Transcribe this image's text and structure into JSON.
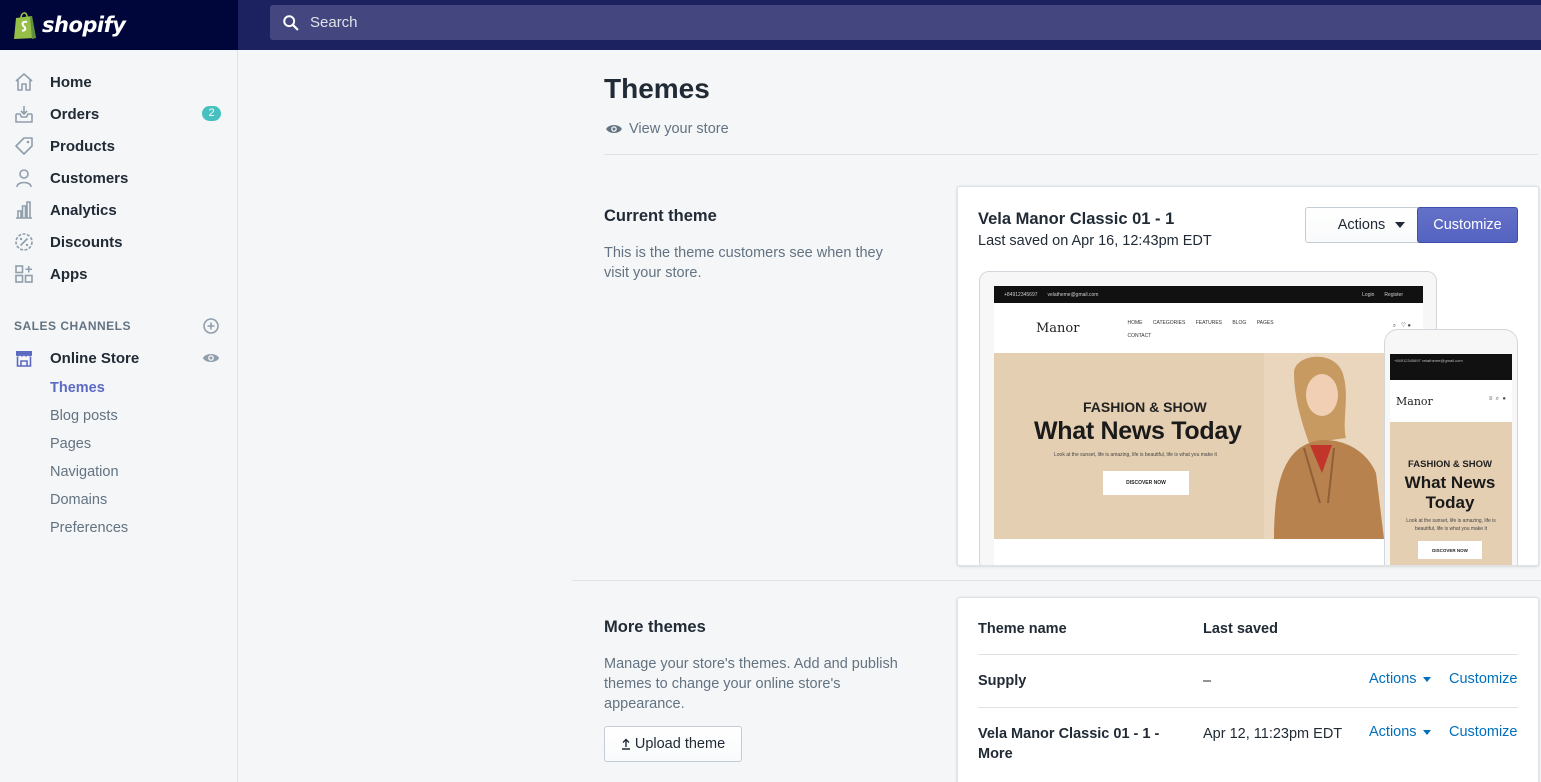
{
  "brand": {
    "name": "shopify"
  },
  "search": {
    "placeholder": "Search"
  },
  "sidebar": {
    "items": [
      {
        "label": "Home",
        "icon": "home-icon"
      },
      {
        "label": "Orders",
        "icon": "orders-icon",
        "badge": "2"
      },
      {
        "label": "Products",
        "icon": "tag-icon"
      },
      {
        "label": "Customers",
        "icon": "person-icon"
      },
      {
        "label": "Analytics",
        "icon": "bar-chart-icon"
      },
      {
        "label": "Discounts",
        "icon": "discount-icon"
      },
      {
        "label": "Apps",
        "icon": "apps-icon"
      }
    ],
    "sales_channels_heading": "SALES CHANNELS",
    "online_store": {
      "label": "Online Store",
      "icon": "store-icon"
    },
    "sub_items": [
      "Themes",
      "Blog posts",
      "Pages",
      "Navigation",
      "Domains",
      "Preferences"
    ],
    "active_sub_item": "Themes"
  },
  "page": {
    "title": "Themes",
    "view_store": "View your store"
  },
  "current_theme": {
    "heading": "Current theme",
    "description": "This is the theme customers see when they visit your store.",
    "name": "Vela Manor Classic 01 - 1",
    "last_saved": "Last saved on Apr 16, 12:43pm EDT",
    "actions_label": "Actions",
    "customize_label": "Customize",
    "preview": {
      "topbar_phone": "+84912345697",
      "topbar_email": "velatheme@gmail.com",
      "topbar_login": "Login",
      "topbar_register": "Register",
      "logo": "Manor",
      "menu": [
        "HOME",
        "CATEGORIES",
        "FEATURES",
        "BLOG",
        "PAGES",
        "CONTACT"
      ],
      "hero_kicker": "FASHION & SHOW",
      "hero_title": "What News Today",
      "hero_sub": "Look at the sunset, life is amazing, life is beautiful, life is what you make it",
      "hero_button": "DISCOVER NOW",
      "phone_title_line1": "What News",
      "phone_title_line2": "Today"
    }
  },
  "more_themes": {
    "heading": "More themes",
    "description": "Manage your store's themes. Add and publish themes to change your online store's appearance.",
    "upload_label": "Upload theme",
    "columns": [
      "Theme name",
      "Last saved"
    ],
    "rows": [
      {
        "name": "Supply",
        "last_saved": "–",
        "actions": "Actions",
        "customize": "Customize"
      },
      {
        "name": "Vela Manor Classic 01 - 1 - More",
        "last_saved": "Apr 12, 11:23pm EDT",
        "actions": "Actions",
        "customize": "Customize"
      }
    ]
  },
  "colors": {
    "topbar": "#1c2260",
    "logo_bg": "#000639",
    "accent": "#5c6ac4",
    "link": "#006fbb",
    "badge": "#47c1bf"
  }
}
